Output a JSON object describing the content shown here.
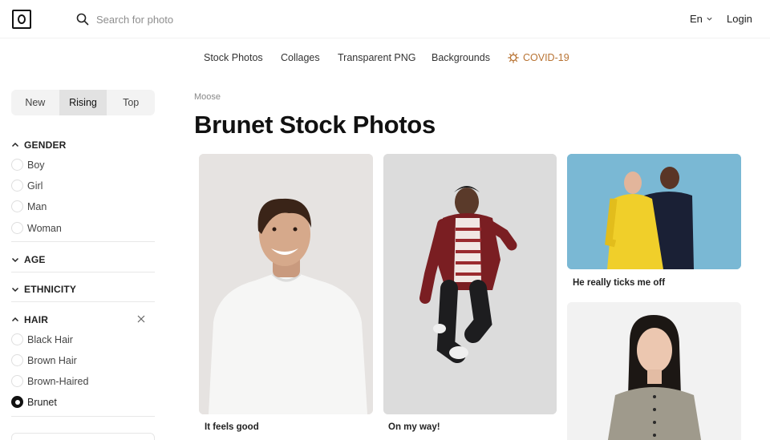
{
  "header": {
    "search_placeholder": "Search for photo",
    "language": "En",
    "login": "Login"
  },
  "nav": {
    "items": [
      "Stock Photos",
      "Collages",
      "Transparent PNG",
      "Backgrounds"
    ],
    "covid": "COVID-19"
  },
  "sidebar": {
    "tabs": [
      "New",
      "Rising",
      "Top"
    ],
    "active_tab": "Rising",
    "gender": {
      "title": "GENDER",
      "options": [
        "Boy",
        "Girl",
        "Man",
        "Woman"
      ]
    },
    "age": {
      "title": "AGE"
    },
    "ethnicity": {
      "title": "ETHNICITY"
    },
    "hair": {
      "title": "HAIR",
      "options": [
        "Black Hair",
        "Brown Hair",
        "Brown-Haired",
        "Brunet"
      ],
      "selected": "Brunet"
    }
  },
  "main": {
    "breadcrumb": "Moose",
    "title": "Brunet Stock Photos",
    "photos": [
      {
        "caption": "It feels good"
      },
      {
        "caption": "On my way!"
      },
      {
        "caption": "He really ticks me off"
      },
      {
        "caption": ""
      }
    ]
  },
  "colors": {
    "accent_covid": "#b87333",
    "card3_bg": "#7ab8d4"
  }
}
